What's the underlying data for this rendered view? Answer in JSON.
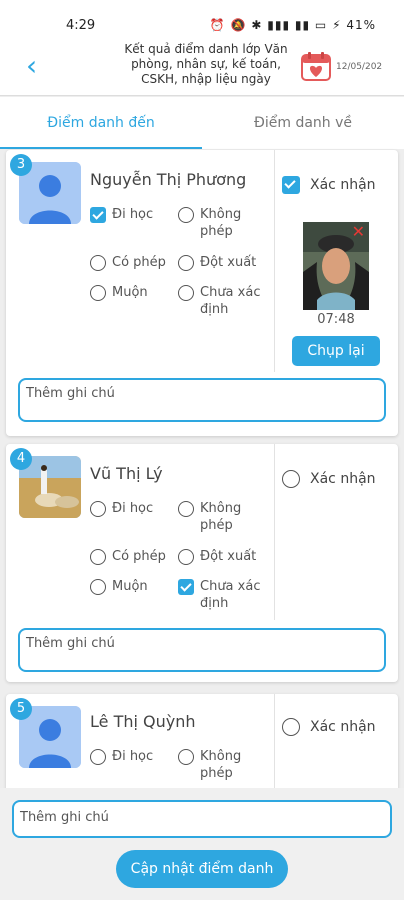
{
  "status_bar": {
    "time": "4:29",
    "battery": "41%",
    "icons": "⏰ 🔕 ✱ ▮▮▮ ▮▮ ▭ ⚡"
  },
  "header": {
    "title": "Kết quả điểm danh lớp Văn phòng, nhân sự, kế toán, CSKH, nhập liệu ngày",
    "date": "12/05/202",
    "colors": {
      "accent": "#2ea7e0"
    }
  },
  "tabs": [
    {
      "label": "Điểm danh đến",
      "active": true
    },
    {
      "label": "Điểm danh về",
      "active": false
    }
  ],
  "options": {
    "present": "Đi học",
    "unexcused": "Không phép",
    "excused": "Có phép",
    "sudden": "Đột xuất",
    "late": "Muộn",
    "undetermined": "Chưa xác định"
  },
  "confirm_label": "Xác nhận",
  "note_placeholder": "Thêm ghi chú",
  "students": [
    {
      "index": "3",
      "name": "Nguyễn Thị Phương",
      "selected": "present",
      "confirmed": true,
      "photo_time": "07:48",
      "retake_label": "Chụp lại"
    },
    {
      "index": "4",
      "name": "Vũ Thị Lý",
      "selected": "undetermined",
      "confirmed": false
    },
    {
      "index": "5",
      "name": "Lê Thị Quỳnh",
      "selected": null,
      "confirmed": false
    }
  ],
  "bottom": {
    "note_placeholder": "Thêm ghi chú",
    "update_label": "Cập nhật điểm danh"
  }
}
